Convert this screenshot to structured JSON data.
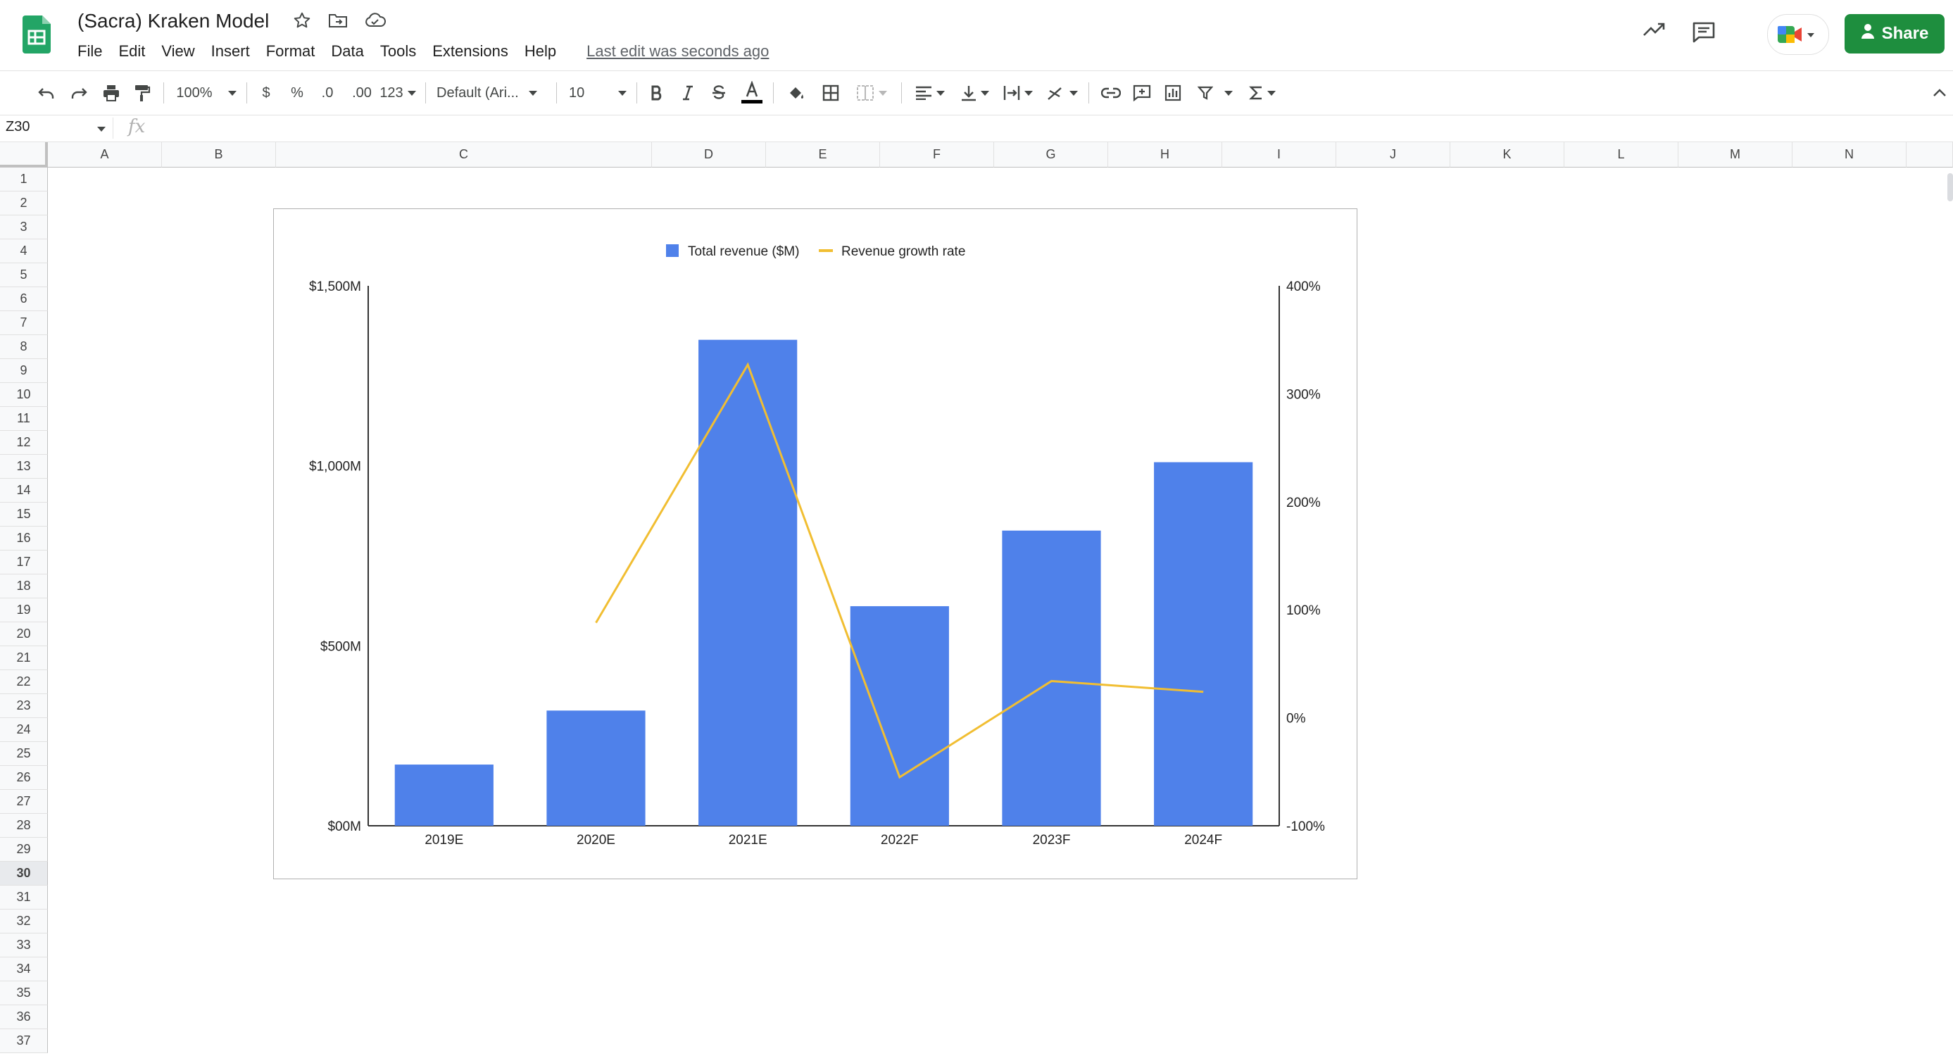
{
  "app": {
    "doc_title": "(Sacra) Kraken Model",
    "menus": [
      "File",
      "Edit",
      "View",
      "Insert",
      "Format",
      "Data",
      "Tools",
      "Extensions",
      "Help"
    ],
    "last_edit": "Last edit was seconds ago",
    "share_label": "Share"
  },
  "toolbar": {
    "zoom": "100%",
    "currency": "$",
    "percent": "%",
    "decrease_decimal": ".0",
    "increase_decimal": ".00",
    "more_formats": "123",
    "font": "Default (Ari...",
    "font_size": "10"
  },
  "formula_bar": {
    "cell_ref": "Z30",
    "fx": "fx"
  },
  "grid": {
    "columns": [
      "A",
      "B",
      "C",
      "D",
      "E",
      "F",
      "G",
      "H",
      "I",
      "J",
      "K",
      "L",
      "M",
      "N"
    ],
    "rows": [
      "1",
      "2",
      "3",
      "4",
      "5",
      "6",
      "7",
      "8",
      "9",
      "10",
      "11",
      "12",
      "13",
      "14",
      "15",
      "16",
      "17",
      "18",
      "19",
      "20",
      "21",
      "22",
      "23",
      "24",
      "25",
      "26",
      "27",
      "28",
      "29",
      "30",
      "31",
      "32",
      "33",
      "34",
      "35",
      "36",
      "37"
    ],
    "selected_row": "30"
  },
  "chart_data": {
    "type": "bar",
    "title": "",
    "xlabel": "",
    "ylabel": "",
    "legend_position": "top",
    "categories": [
      "2019E",
      "2020E",
      "2021E",
      "2022F",
      "2023F",
      "2024F"
    ],
    "series": [
      {
        "name": "Total revenue ($M)",
        "type": "bar",
        "axis": "left",
        "color": "#4f81ea",
        "values": [
          170,
          320,
          1350,
          610,
          820,
          1010
        ]
      },
      {
        "name": "Revenue growth rate",
        "type": "line",
        "axis": "right",
        "color": "#f1be32",
        "values": [
          null,
          88,
          327,
          -55,
          34,
          24
        ]
      }
    ],
    "y_left": {
      "ylim": [
        0,
        1500
      ],
      "ticks": [
        0,
        500,
        1000,
        1500
      ],
      "tick_labels": [
        "$00M",
        "$500M",
        "$1,000M",
        "$1,500M"
      ]
    },
    "y_right": {
      "ylim": [
        -100,
        400
      ],
      "ticks": [
        -100,
        0,
        100,
        200,
        300,
        400
      ],
      "tick_labels": [
        "-100%",
        "0%",
        "100%",
        "200%",
        "300%",
        "400%"
      ]
    },
    "grid": false
  }
}
